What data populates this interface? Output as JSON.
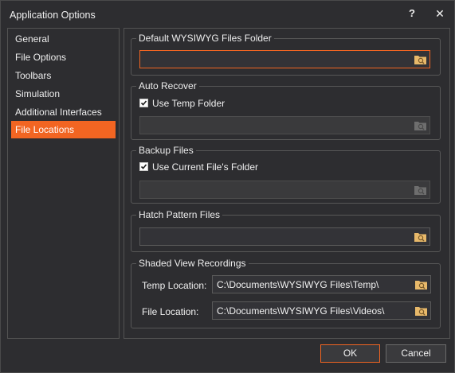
{
  "window": {
    "title": "Application Options",
    "help_label": "?",
    "close_label": "✕"
  },
  "sidebar": {
    "items": [
      {
        "label": "General"
      },
      {
        "label": "File Options"
      },
      {
        "label": "Toolbars"
      },
      {
        "label": "Simulation"
      },
      {
        "label": "Additional Interfaces"
      },
      {
        "label": "File Locations",
        "selected": true
      }
    ]
  },
  "groups": {
    "default_folder": {
      "title": "Default WYSIWYG Files Folder",
      "value": ""
    },
    "auto_recover": {
      "title": "Auto Recover",
      "checkbox_label": "Use Temp Folder",
      "checked": true,
      "value": ""
    },
    "backup_files": {
      "title": "Backup Files",
      "checkbox_label": "Use Current File's Folder",
      "checked": true,
      "value": ""
    },
    "hatch_pattern": {
      "title": "Hatch Pattern Files",
      "value": ""
    },
    "shaded_view": {
      "title": "Shaded View Recordings",
      "temp_label": "Temp Location:",
      "temp_value": "C:\\Documents\\WYSIWYG Files\\Temp\\",
      "file_label": "File Location:",
      "file_value": "C:\\Documents\\WYSIWYG Files\\Videos\\"
    }
  },
  "footer": {
    "ok_label": "OK",
    "cancel_label": "Cancel"
  },
  "colors": {
    "accent": "#f26522",
    "background": "#2d2d30",
    "folder_icon": "#e8b96a"
  },
  "icons": {
    "browse": "folder-search-icon"
  }
}
